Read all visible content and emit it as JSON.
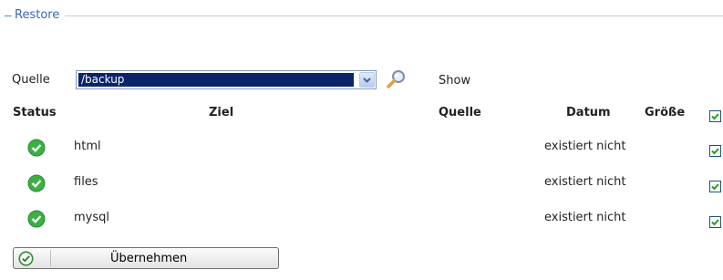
{
  "fieldset": {
    "legend": "Restore"
  },
  "source": {
    "label": "Quelle",
    "selected": "/backup"
  },
  "show_label": "Show",
  "columns": {
    "status": "Status",
    "ziel": "Ziel",
    "quelle": "Quelle",
    "datum": "Datum",
    "groesse": "Größe"
  },
  "rows": [
    {
      "name": "html",
      "datum": "existiert nicht",
      "checked": true
    },
    {
      "name": "files",
      "datum": "existiert nicht",
      "checked": true
    },
    {
      "name": "mysql",
      "datum": "existiert nicht",
      "checked": true
    }
  ],
  "header_checkbox_checked": true,
  "apply_button": {
    "label": "Übernehmen"
  },
  "colors": {
    "accent": "#3a66b5",
    "ok_green": "#3cb043",
    "select_highlight": "#0a246a"
  }
}
